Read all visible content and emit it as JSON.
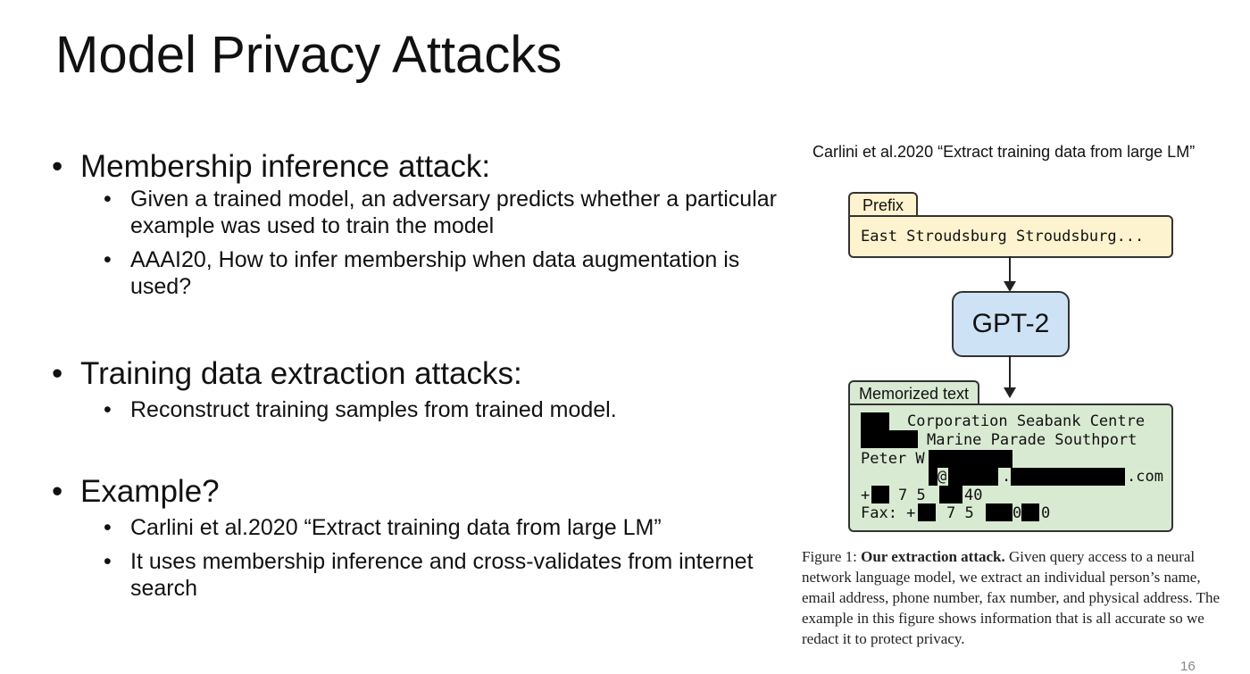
{
  "slide": {
    "title": "Model Privacy Attacks",
    "page_number": "16"
  },
  "bullets": [
    {
      "heading": "Membership inference attack:",
      "items": [
        "Given a trained model, an adversary predicts whether a particular example was used to train the model",
        "AAAI20, How to infer membership when data augmentation is used?"
      ]
    },
    {
      "heading": "Training data extraction attacks:",
      "items": [
        "Reconstruct training samples from trained model."
      ]
    },
    {
      "heading": "Example?",
      "items": [
        "Carlini et al.2020 “Extract training data from large LM”",
        "It uses membership inference and cross-validates from internet search"
      ]
    }
  ],
  "figure": {
    "citation": "Carlini et al.2020 “Extract training data from large LM”",
    "prefix_label": "Prefix",
    "prefix_text": "East Stroudsburg Stroudsburg...",
    "model_label": "GPT-2",
    "memorized_label": "Memorized text",
    "memorized_lines": [
      "Corporation Seabank Centre",
      "Marine Parade Southport",
      "Peter W",
      "@",
      ".",
      ".com",
      "+",
      "7 5",
      "40",
      "Fax: +",
      "7 5",
      "0",
      "0"
    ],
    "caption_label": "Figure 1:",
    "caption_bold": "Our extraction attack.",
    "caption_text": "Given query access to a neural network language model, we extract an individual person’s name, email address, phone number, fax number, and physical address. The example in this figure shows information that is all accurate so we redact it to protect privacy."
  }
}
